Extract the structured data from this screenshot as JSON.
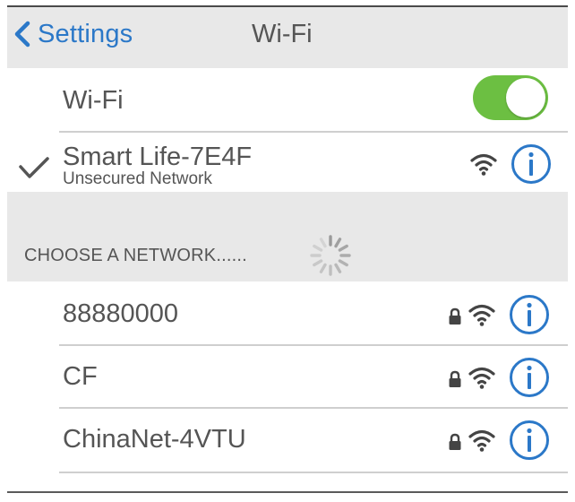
{
  "nav": {
    "back_label": "Settings",
    "title": "Wi-Fi"
  },
  "wifi_toggle": {
    "label": "Wi-Fi",
    "enabled": true
  },
  "connected_network": {
    "name": "Smart Life-7E4F",
    "subtitle": "Unsecured Network"
  },
  "section": {
    "title": "CHOOSE A NETWORK......"
  },
  "networks": [
    {
      "name": "88880000",
      "secured": true
    },
    {
      "name": "CF",
      "secured": true
    },
    {
      "name": "ChinaNet-4VTU",
      "secured": true
    }
  ],
  "colors": {
    "accent": "#2b78c8",
    "toggle_on": "#6cbf42",
    "text": "#555555",
    "nav_bg": "#e8e8e8"
  }
}
